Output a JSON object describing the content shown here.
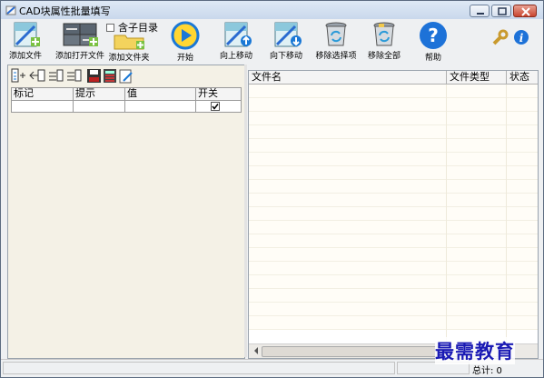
{
  "window": {
    "title": "CAD块属性批量填写"
  },
  "toolbar": {
    "add_file": "添加文件",
    "add_open_files": "添加打开文件",
    "add_folder": "添加文件夹",
    "start": "开始",
    "move_up": "向上移动",
    "move_down": "向下移动",
    "remove_selected": "移除选择项",
    "remove_all": "移除全部",
    "help": "帮助",
    "include_subdirs": "含子目录",
    "include_subdirs_checked": false
  },
  "left_grid": {
    "columns": [
      "标记",
      "提示",
      "值",
      "开关"
    ],
    "rows": [
      {
        "tag": "",
        "prompt": "",
        "value": "",
        "switch_checked": true
      }
    ]
  },
  "file_list": {
    "columns": [
      "文件名",
      "文件类型",
      "状态"
    ],
    "rows": []
  },
  "status": {
    "total": "总计: 0"
  },
  "watermark": "最需教育",
  "colors": {
    "accent_blue": "#1a78d6",
    "help_blue": "#1d72d8",
    "title_gradient": "#c9d8ec"
  }
}
